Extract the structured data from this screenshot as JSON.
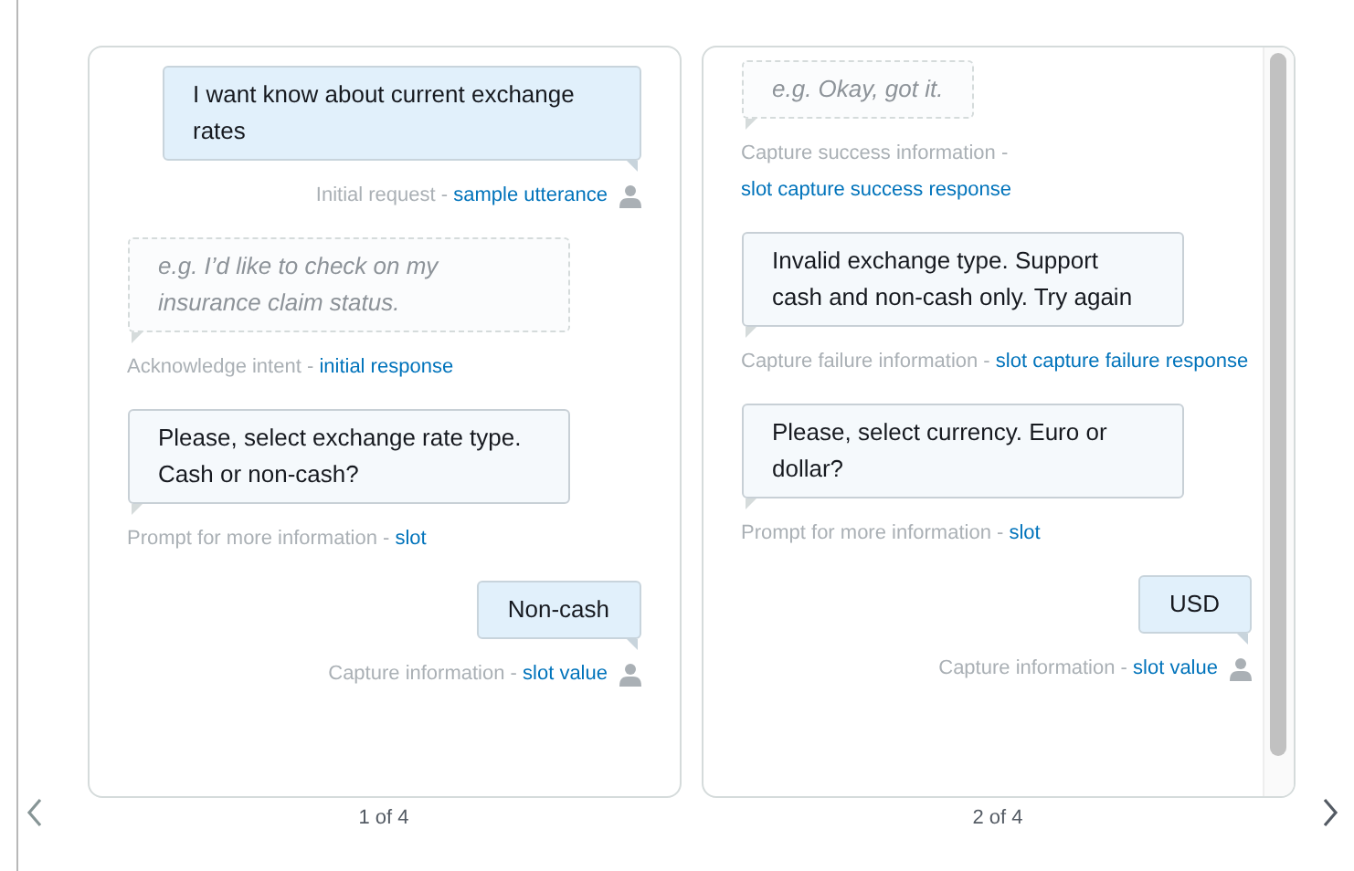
{
  "cards": [
    {
      "messages": [
        {
          "kind": "user",
          "text": "I want know about current exchange rates",
          "caption": "Initial request -",
          "link": "sample utterance"
        },
        {
          "kind": "placeholder",
          "text": "e.g. I’d like to check on my insurance claim status.",
          "caption": "Acknowledge intent -",
          "link": "initial response"
        },
        {
          "kind": "bot",
          "text": "Please, select exchange rate type. Cash or non-cash?",
          "caption": "Prompt for more information -",
          "link": "slot"
        },
        {
          "kind": "user",
          "text": "Non-cash",
          "caption": "Capture information -",
          "link": "slot value"
        }
      ],
      "page": "1 of 4",
      "scrollbar": false
    },
    {
      "messages": [
        {
          "kind": "placeholder",
          "text": "e.g. Okay, got it.",
          "caption": "Capture success information -",
          "link": "slot capture success response"
        },
        {
          "kind": "bot",
          "text": "Invalid exchange type. Support cash and non-cash only. Try again",
          "caption": "Capture failure information -",
          "link": "slot capture failure response"
        },
        {
          "kind": "bot",
          "text": "Please, select currency. Euro or dollar?",
          "caption": "Prompt for more information -",
          "link": "slot"
        },
        {
          "kind": "user",
          "text": "USD",
          "caption": "Capture information -",
          "link": "slot value"
        }
      ],
      "page": "2 of 4",
      "scrollbar": true
    }
  ]
}
